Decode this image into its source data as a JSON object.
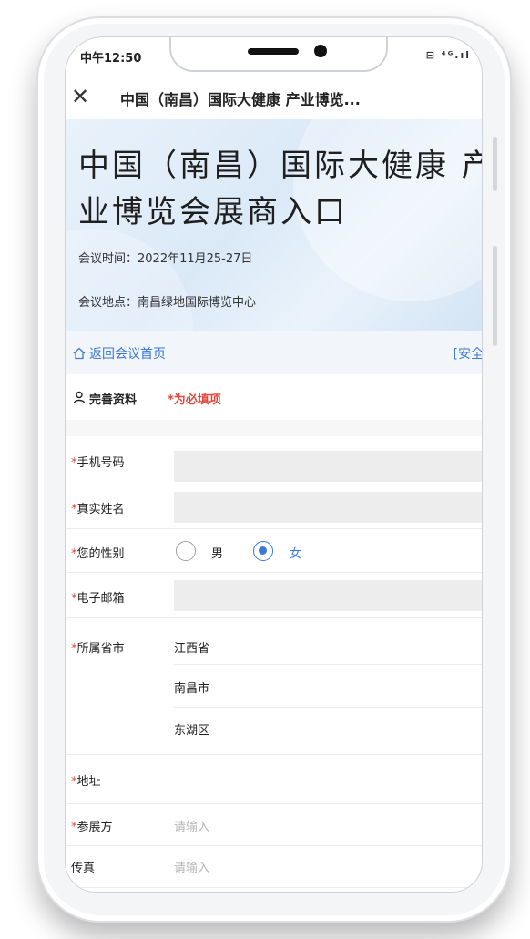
{
  "status_bar": {
    "time": "中午12:50 ",
    "icons": "⊟ ⁴ᴳ.ıl"
  },
  "nav": {
    "close_icon": "close-icon",
    "title": "中国（南昌）国际大健康 产业博览..."
  },
  "hero": {
    "title": "中国（南昌）国际大健康 产业博览会展商入口",
    "time_label": "会议时间：",
    "time_value": "2022年11月25-27日",
    "place_label": "会议地点：",
    "place_value": "南昌绿地国际博览中心"
  },
  "links": {
    "home": "返回会议首页",
    "safety": "[安全"
  },
  "section": {
    "title": "完善资料",
    "hint": "*为必填项"
  },
  "form": {
    "required_mark": "*",
    "phone": {
      "label": "手机号码",
      "value": ""
    },
    "name": {
      "label": "真实姓名",
      "value": ""
    },
    "gender": {
      "label": "您的性别",
      "options": [
        "男",
        "女"
      ],
      "selected": "女"
    },
    "email": {
      "label": "电子邮箱",
      "value": ""
    },
    "region": {
      "label": "所属省市",
      "province": "江西省",
      "city": "南昌市",
      "district": "东湖区"
    },
    "address": {
      "label": "地址",
      "value": ""
    },
    "exhibitor": {
      "label": "参展方",
      "placeholder": "请输入"
    },
    "fax": {
      "label": "传真",
      "placeholder": "请输入"
    }
  },
  "colors": {
    "accent": "#3a78d8",
    "required": "#e2483d"
  }
}
